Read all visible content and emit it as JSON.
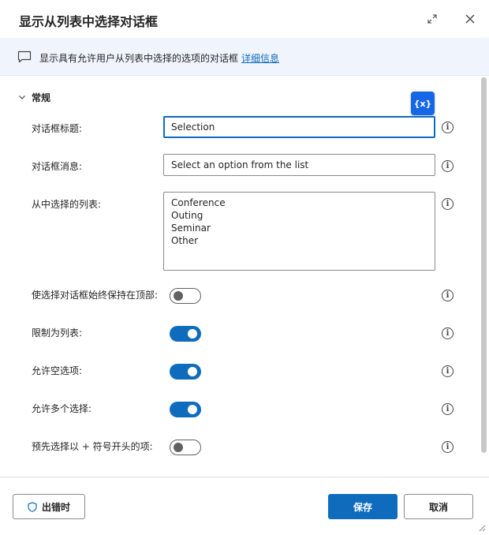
{
  "dialog": {
    "title": "显示从列表中选择对话框"
  },
  "banner": {
    "text": "显示具有允许用户从列表中选择的选项的对话框",
    "link": "详细信息"
  },
  "section": {
    "title": "常规"
  },
  "variable_button": {
    "label": "{x}"
  },
  "fields": {
    "dialog_title": {
      "label": "对话框标题:",
      "value": "Selection"
    },
    "dialog_message": {
      "label": "对话框消息:",
      "value": "Select an option from the list"
    },
    "list": {
      "label": "从中选择的列表:",
      "items": [
        "Conference",
        "Outing",
        "Seminar",
        "Other"
      ]
    }
  },
  "toggles": [
    {
      "label": "使选择对话框始终保持在顶部:",
      "on": false
    },
    {
      "label": "限制为列表:",
      "on": true
    },
    {
      "label": "允许空选项:",
      "on": true
    },
    {
      "label": "允许多个选择:",
      "on": true
    },
    {
      "label": "预先选择以 + 符号开头的项:",
      "on": false
    }
  ],
  "footer": {
    "on_error": "出错时",
    "save": "保存",
    "cancel": "取消"
  },
  "info_glyph": "i",
  "colors": {
    "accent": "#0f6cbd",
    "variable_button": "#1667e6",
    "banner_bg": "#f0f4fd"
  }
}
